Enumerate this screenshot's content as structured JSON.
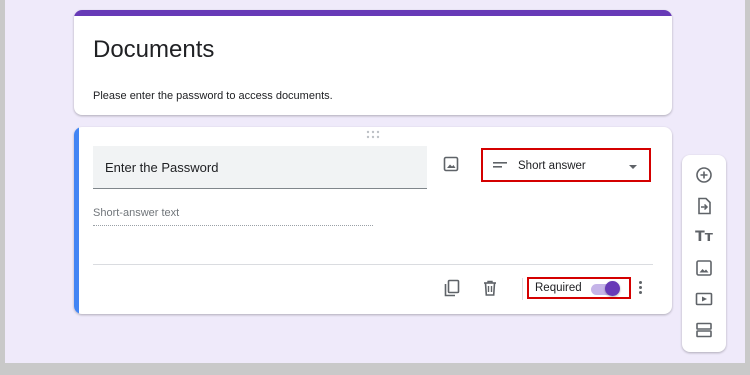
{
  "form": {
    "title": "Documents",
    "description": "Please enter the password to access documents."
  },
  "question": {
    "title": "Enter the Password",
    "type_label": "Short answer",
    "answer_placeholder": "Short-answer text",
    "required_label": "Required",
    "required": true
  },
  "toolbar": {
    "items": [
      "add-question-icon",
      "import-questions-icon",
      "add-title-icon",
      "add-image-icon",
      "add-video-icon",
      "add-section-icon"
    ],
    "add_title_glyph": "Tт"
  },
  "colors": {
    "accent": "#673ab7",
    "focus_bar": "#4285f4",
    "highlight_box": "#d40000",
    "background": "#efeafa"
  }
}
